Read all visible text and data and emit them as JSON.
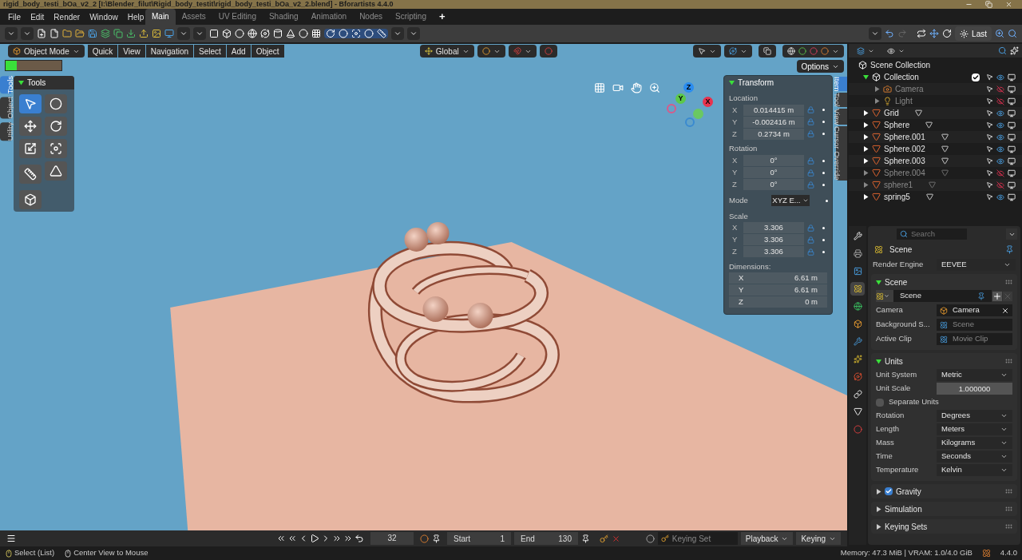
{
  "title_bar": {
    "title": "rigid_body_testi_bOa_v2_2 [I:\\Blender_filut\\Rigid_body_testit\\rigid_body_testi_bOa_v2_2.blend] - Bforartists 4.4.0"
  },
  "menu": [
    "File",
    "Edit",
    "Render",
    "Window",
    "Help"
  ],
  "workspaces": [
    {
      "label": "Main",
      "selected": true
    },
    {
      "label": "Assets",
      "selected": false
    },
    {
      "label": "UV Editing",
      "selected": false
    },
    {
      "label": "Shading",
      "selected": false
    },
    {
      "label": "Animation",
      "selected": false
    },
    {
      "label": "Nodes",
      "selected": false
    },
    {
      "label": "Scripting",
      "selected": false
    }
  ],
  "add_workspace": "+",
  "toolbar": {
    "last_button": "Last"
  },
  "viewport": {
    "mode": "Object Mode",
    "menus": [
      "Quick",
      "View",
      "Navigation",
      "Select",
      "Add",
      "Object"
    ],
    "orientation": "Global",
    "options": "Options",
    "left_tabs": [
      {
        "label": "Tools",
        "selected": true
      },
      {
        "label": "Object",
        "selected": false
      },
      {
        "label": "Utility",
        "selected": false
      }
    ],
    "tools_panel": {
      "title": "Tools"
    },
    "gizmo_axes": [
      "Z",
      "Y",
      "X"
    ],
    "right_tabs": [
      {
        "label": "Item",
        "selected": true
      },
      {
        "label": "Tool",
        "selected": false
      },
      {
        "label": "View",
        "selected": false
      },
      {
        "label": "Cursor Override",
        "selected": false
      }
    ],
    "transform": {
      "title": "Transform",
      "location": {
        "label": "Location",
        "fields": [
          {
            "axis": "X",
            "value": "0.014415 m"
          },
          {
            "axis": "Y",
            "value": "-0.002416 m"
          },
          {
            "axis": "Z",
            "value": "0.2734 m"
          }
        ]
      },
      "rotation": {
        "label": "Rotation",
        "fields": [
          {
            "axis": "X",
            "value": "0°"
          },
          {
            "axis": "Y",
            "value": "0°"
          },
          {
            "axis": "Z",
            "value": "0°"
          }
        ]
      },
      "mode": {
        "label": "Mode",
        "value": "XYZ E..."
      },
      "scale": {
        "label": "Scale",
        "fields": [
          {
            "axis": "X",
            "value": "3.306"
          },
          {
            "axis": "Y",
            "value": "3.306"
          },
          {
            "axis": "Z",
            "value": "3.306"
          }
        ]
      },
      "dimensions": {
        "label": "Dimensions:",
        "fields": [
          {
            "axis": "X",
            "value": "6.61 m"
          },
          {
            "axis": "Y",
            "value": "6.61 m"
          },
          {
            "axis": "Z",
            "value": "0 m"
          }
        ]
      }
    }
  },
  "outliner": {
    "root": "Scene Collection",
    "items": [
      {
        "name": "Collection",
        "kind": "collection",
        "checked": true,
        "expanded": true,
        "visible": true,
        "children": [
          {
            "name": "Camera",
            "kind": "camera",
            "visible": false
          },
          {
            "name": "Light",
            "kind": "light",
            "visible": false
          }
        ]
      },
      {
        "name": "Grid",
        "kind": "mesh",
        "visible": true
      },
      {
        "name": "Sphere",
        "kind": "mesh",
        "visible": true
      },
      {
        "name": "Sphere.001",
        "kind": "mesh",
        "visible": true
      },
      {
        "name": "Sphere.002",
        "kind": "mesh",
        "visible": true
      },
      {
        "name": "Sphere.003",
        "kind": "mesh",
        "visible": true
      },
      {
        "name": "Sphere.004",
        "kind": "mesh",
        "visible": false
      },
      {
        "name": "sphere1",
        "kind": "mesh",
        "visible": false
      },
      {
        "name": "spring5",
        "kind": "mesh",
        "visible": true
      }
    ]
  },
  "properties": {
    "search_placeholder": "Search",
    "tabs": [
      {
        "kind": "tool",
        "selected": false
      },
      {
        "kind": "render",
        "selected": false
      },
      {
        "kind": "output",
        "selected": false
      },
      {
        "kind": "scene",
        "selected": true
      },
      {
        "kind": "world",
        "selected": false
      },
      {
        "kind": "object",
        "selected": false
      },
      {
        "kind": "modifiers",
        "selected": false
      },
      {
        "kind": "particles",
        "selected": false
      },
      {
        "kind": "physics",
        "selected": false
      },
      {
        "kind": "constraints",
        "selected": false
      },
      {
        "kind": "data",
        "selected": false
      },
      {
        "kind": "material",
        "selected": false
      }
    ],
    "header": "Scene",
    "render_engine": {
      "label": "Render Engine",
      "value": "EEVEE"
    },
    "scene_section": {
      "title": "Scene",
      "expanded": true,
      "datablock": "Scene",
      "rows": [
        {
          "label": "Camera",
          "value": "Camera"
        },
        {
          "label": "Background S...",
          "placeholder": "Scene"
        },
        {
          "label": "Active Clip",
          "placeholder": "Movie Clip"
        }
      ]
    },
    "units_section": {
      "title": "Units",
      "expanded": true,
      "rows": [
        {
          "kind": "dropdown",
          "label": "Unit System",
          "value": "Metric"
        },
        {
          "kind": "number",
          "label": "Unit Scale",
          "value": "1.000000"
        },
        {
          "kind": "checkbox",
          "label": "Separate Units",
          "checked": false
        },
        {
          "kind": "dropdown",
          "label": "Rotation",
          "value": "Degrees"
        },
        {
          "kind": "dropdown",
          "label": "Length",
          "value": "Meters"
        },
        {
          "kind": "dropdown",
          "label": "Mass",
          "value": "Kilograms"
        },
        {
          "kind": "dropdown",
          "label": "Time",
          "value": "Seconds"
        },
        {
          "kind": "dropdown",
          "label": "Temperature",
          "value": "Kelvin"
        }
      ]
    },
    "collapsed_sections": [
      {
        "title": "Gravity",
        "expanded": false,
        "kind": "checkbox",
        "checked": true
      },
      {
        "title": "Simulation",
        "expanded": false,
        "kind": "plain"
      },
      {
        "title": "Keying Sets",
        "expanded": false,
        "kind": "plain"
      }
    ]
  },
  "timeline": {
    "frame": "32",
    "start_label": "Start",
    "start": "1",
    "end_label": "End",
    "end": "130",
    "keying_set_placeholder": "Keying Set",
    "playback": "Playback",
    "keying": "Keying"
  },
  "status_bar": {
    "hints": [
      {
        "kind": "mouse_left",
        "text": "Select (List)"
      },
      {
        "kind": "mouse_middle",
        "text": "Center View to Mouse"
      }
    ],
    "memory": "Memory: 47.3 MiB | VRAM: 1.0/4.0 GiB",
    "version": "4.4.0"
  }
}
